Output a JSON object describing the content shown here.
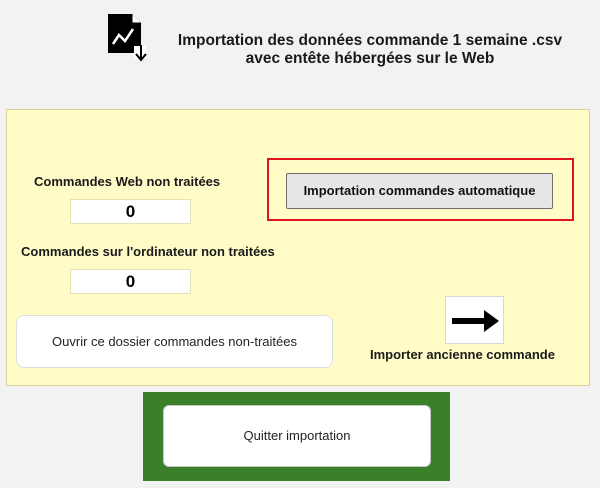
{
  "header": {
    "icon": "csv-import-chart-icon",
    "title_line1": "Importation des données commande 1 semaine .csv",
    "title_line2": "avec entête hébergées sur le Web"
  },
  "panel": {
    "web_label": "Commandes Web non traitées",
    "web_count": "0",
    "computer_label": "Commandes sur l'ordinateur non traitées",
    "computer_count": "0",
    "auto_import_label": "Importation commandes automatique",
    "open_folder_label": "Ouvrir ce  dossier commandes non-traitées",
    "import_old_label": "Importer ancienne commande",
    "import_old_icon": "arrow-right-icon"
  },
  "footer": {
    "quit_label": "Quitter importation"
  },
  "colors": {
    "panel_background": "#fffcc8",
    "highlight_border": "#e0151c",
    "footer_background": "#3a7f2a"
  }
}
